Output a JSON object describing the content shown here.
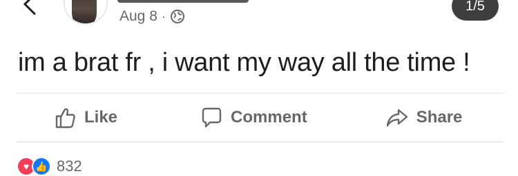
{
  "post": {
    "date": "Aug 8",
    "separator": "·",
    "privacy_icon": "globe-icon",
    "text": "im a brat fr , i want my way all the time !"
  },
  "viewer": {
    "counter": "1/5"
  },
  "actions": {
    "like_label": "Like",
    "comment_label": "Comment",
    "share_label": "Share"
  },
  "reactions": {
    "types": [
      "love-icon",
      "like-icon"
    ],
    "count": "832"
  },
  "colors": {
    "meta_text": "#65676b",
    "love": "#f33e58",
    "like": "#1877f2"
  }
}
